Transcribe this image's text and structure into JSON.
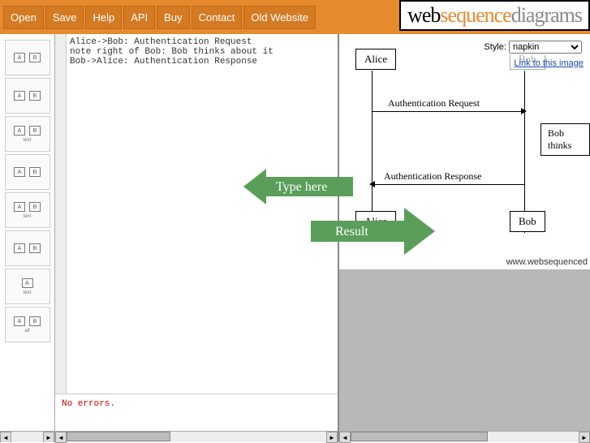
{
  "menu": {
    "open": "Open",
    "save": "Save",
    "help": "Help",
    "api": "API",
    "buy": "Buy",
    "contact": "Contact",
    "old": "Old Website"
  },
  "logo": {
    "part1": "web",
    "part2": "sequence",
    "part3": "diagrams"
  },
  "editor": {
    "line1": "Alice->Bob: Authentication Request",
    "line2": "note right of Bob: Bob thinks about it",
    "line3": "Bob->Alice: Authentication Response"
  },
  "status": {
    "text": "No errors."
  },
  "style": {
    "label": "Style:",
    "value": "napkin",
    "link": "Link to this image"
  },
  "diagram": {
    "actor1": "Alice",
    "actor2": "Bob",
    "msg1": "Authentication Request",
    "msg2": "Authentication Response",
    "note": "Bob thinks",
    "watermark": "www.websequenced"
  },
  "callout": {
    "type": "Type here",
    "result": "Result"
  },
  "thumbs": {
    "a": "A",
    "b": "B",
    "text": "text",
    "alt": "alt"
  }
}
